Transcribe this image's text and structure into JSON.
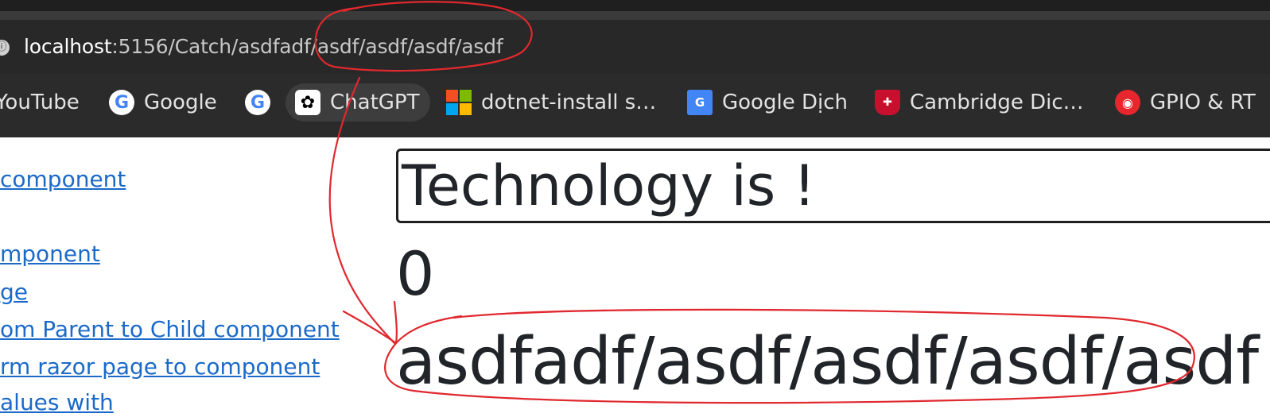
{
  "browser": {
    "url_host": "localhost",
    "url_rest": ":5156/Catch/asdfadf/asdf/asdf/asdf/asdf",
    "bookmarks": [
      {
        "label": "YouTube",
        "icon": "youtube-icon"
      },
      {
        "label": "Google",
        "icon": "google-icon"
      },
      {
        "label": "",
        "icon": "google-icon"
      },
      {
        "label": "ChatGPT",
        "icon": "openai-icon"
      },
      {
        "label": "dotnet-install s…",
        "icon": "microsoft-icon"
      },
      {
        "label": "Google Dịch",
        "icon": "google-translate-icon"
      },
      {
        "label": "Cambridge Dic…",
        "icon": "cambridge-icon"
      },
      {
        "label": "GPIO & RT",
        "icon": "espressif-icon"
      }
    ]
  },
  "sidebar": {
    "links": [
      "component",
      "mponent",
      "ge",
      "om Parent to Child component",
      "rm razor page to component",
      "alues with"
    ]
  },
  "main": {
    "input_value": "Technology is !",
    "counter": "0",
    "route_param": "asdfadf/asdf/asdf/asdf/asdf"
  },
  "annotation": {
    "color": "#e0282e"
  }
}
